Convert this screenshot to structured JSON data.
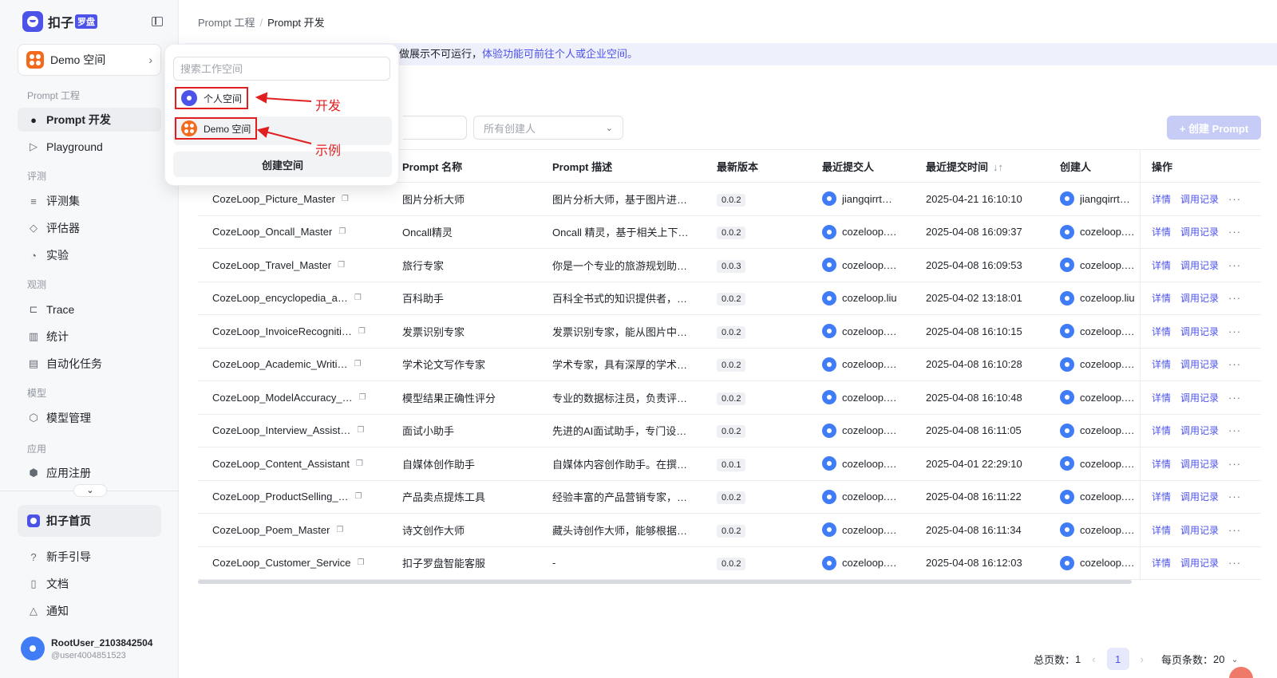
{
  "brand": {
    "name": "扣子",
    "badge": "罗盘"
  },
  "workspace": {
    "current": "Demo 空间"
  },
  "sidebar": {
    "groups": {
      "prompt": "Prompt 工程",
      "eval": "评测",
      "observe": "观测",
      "model": "模型",
      "app": "应用"
    },
    "items": {
      "prompt_dev": "Prompt 开发",
      "playground": "Playground",
      "eval_set": "评测集",
      "evaluator": "评估器",
      "experiment": "实验",
      "trace": "Trace",
      "stats": "统计",
      "auto_task": "自动化任务",
      "model_mgmt": "模型管理",
      "app_register": "应用注册"
    },
    "home": "扣子首页",
    "bottom": {
      "guide": "新手引导",
      "docs": "文档",
      "notify": "通知"
    }
  },
  "user": {
    "name": "RootUser_2103842504",
    "handle": "@user4004851523"
  },
  "breadcrumb": {
    "parent": "Prompt 工程",
    "current": "Prompt 开发"
  },
  "banner": {
    "text": "做展示不可运行，",
    "link": "体验功能可前往个人或企业空间。"
  },
  "filters": {
    "creator_placeholder": "所有创建人"
  },
  "create_button": "+ 创建 Prompt",
  "table": {
    "headers": {
      "name": "Prompt 名称",
      "desc": "Prompt 描述",
      "version": "最新版本",
      "submitter": "最近提交人",
      "time": "最近提交时间",
      "creator": "创建人",
      "action": "操作"
    },
    "action_labels": {
      "detail": "详情",
      "log": "调用记录",
      "more": "···"
    },
    "rows": [
      {
        "key": "CozeLoop_Picture_Master",
        "name": "图片分析大师",
        "desc": "图片分析大师，基于图片进…",
        "version": "0.0.2",
        "submitter": "jiangqirrt…",
        "time": "2025-04-21 16:10:10",
        "creator": "jiangqirrt…"
      },
      {
        "key": "CozeLoop_Oncall_Master",
        "name": "Oncall精灵",
        "desc": "Oncall 精灵，基于相关上下…",
        "version": "0.0.2",
        "submitter": "cozeloop.…",
        "time": "2025-04-08 16:09:37",
        "creator": "cozeloop.…"
      },
      {
        "key": "CozeLoop_Travel_Master",
        "name": "旅行专家",
        "desc": "你是一个专业的旅游规划助…",
        "version": "0.0.3",
        "submitter": "cozeloop.…",
        "time": "2025-04-08 16:09:53",
        "creator": "cozeloop.…"
      },
      {
        "key": "CozeLoop_encyclopedia_a…",
        "name": "百科助手",
        "desc": "百科全书式的知识提供者，…",
        "version": "0.0.2",
        "submitter": "cozeloop.liu",
        "time": "2025-04-02 13:18:01",
        "creator": "cozeloop.liu"
      },
      {
        "key": "CozeLoop_InvoiceRecogniti…",
        "name": "发票识别专家",
        "desc": "发票识别专家，能从图片中…",
        "version": "0.0.2",
        "submitter": "cozeloop.…",
        "time": "2025-04-08 16:10:15",
        "creator": "cozeloop.…"
      },
      {
        "key": "CozeLoop_Academic_Writi…",
        "name": "学术论文写作专家",
        "desc": "学术专家，具有深厚的学术…",
        "version": "0.0.2",
        "submitter": "cozeloop.…",
        "time": "2025-04-08 16:10:28",
        "creator": "cozeloop.…"
      },
      {
        "key": "CozeLoop_ModelAccuracy_…",
        "name": "模型结果正确性评分",
        "desc": "专业的数据标注员，负责评…",
        "version": "0.0.2",
        "submitter": "cozeloop.…",
        "time": "2025-04-08 16:10:48",
        "creator": "cozeloop.…"
      },
      {
        "key": "CozeLoop_Interview_Assist…",
        "name": "面试小助手",
        "desc": "先进的AI面试助手，专门设…",
        "version": "0.0.2",
        "submitter": "cozeloop.…",
        "time": "2025-04-08 16:11:05",
        "creator": "cozeloop.…"
      },
      {
        "key": "CozeLoop_Content_Assistant",
        "name": "自媒体创作助手",
        "desc": "自媒体内容创作助手。在撰…",
        "version": "0.0.1",
        "submitter": "cozeloop.…",
        "time": "2025-04-01 22:29:10",
        "creator": "cozeloop.…"
      },
      {
        "key": "CozeLoop_ProductSelling_…",
        "name": "产品卖点提炼工具",
        "desc": "经验丰富的产品营销专家，…",
        "version": "0.0.2",
        "submitter": "cozeloop.…",
        "time": "2025-04-08 16:11:22",
        "creator": "cozeloop.…"
      },
      {
        "key": "CozeLoop_Poem_Master",
        "name": "诗文创作大师",
        "desc": "藏头诗创作大师，能够根据…",
        "version": "0.0.2",
        "submitter": "cozeloop.…",
        "time": "2025-04-08 16:11:34",
        "creator": "cozeloop.…"
      },
      {
        "key": "CozeLoop_Customer_Service",
        "name": "扣子罗盘智能客服",
        "desc": "-",
        "version": "0.0.2",
        "submitter": "cozeloop.…",
        "time": "2025-04-08 16:12:03",
        "creator": "cozeloop.…"
      }
    ]
  },
  "pagination": {
    "total_label": "总页数：",
    "total": "1",
    "current": "1",
    "page_size_label": "每页条数：",
    "page_size": "20"
  },
  "popup": {
    "search_placeholder": "搜索工作空间",
    "personal": "个人空间",
    "demo": "Demo 空间",
    "create": "创建空间"
  },
  "annotations": {
    "dev": "开发",
    "example": "示例"
  },
  "colors": {
    "accent": "#4d53e8",
    "workspace": "#f26b1d",
    "annotation": "#e02020"
  }
}
